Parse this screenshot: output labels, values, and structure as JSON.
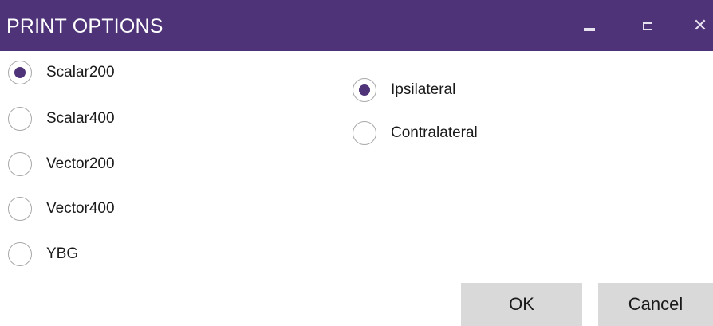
{
  "window": {
    "title": "PRINT OPTIONS",
    "accent_color": "#4e3378",
    "controls": {
      "minimize_icon": "minimize-icon",
      "maximize_icon": "maximize-icon",
      "close_icon": "close-icon"
    }
  },
  "lead_type_options": [
    {
      "label": "Scalar200",
      "selected": true
    },
    {
      "label": "Scalar400",
      "selected": false
    },
    {
      "label": "Vector200",
      "selected": false
    },
    {
      "label": "Vector400",
      "selected": false
    },
    {
      "label": "YBG",
      "selected": false
    }
  ],
  "side_options": [
    {
      "label": "Ipsilateral",
      "selected": true
    },
    {
      "label": "Contralateral",
      "selected": false
    }
  ],
  "buttons": {
    "ok_label": "OK",
    "cancel_label": "Cancel"
  }
}
